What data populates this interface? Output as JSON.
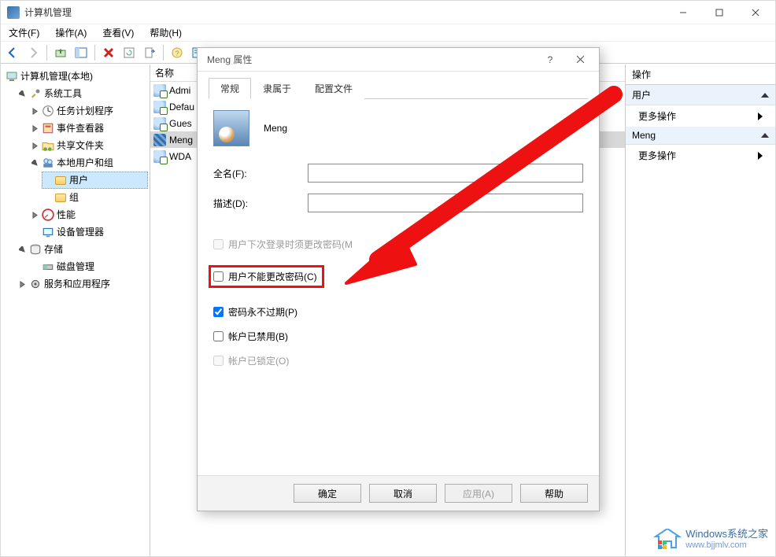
{
  "window": {
    "title": "计算机管理"
  },
  "menu": {
    "file": "文件(F)",
    "action": "操作(A)",
    "view": "查看(V)",
    "help": "帮助(H)"
  },
  "tree": {
    "root": "计算机管理(本地)",
    "system_tools": "系统工具",
    "task_scheduler": "任务计划程序",
    "event_viewer": "事件查看器",
    "shared_folders": "共享文件夹",
    "local_users_groups": "本地用户和组",
    "users": "用户",
    "groups": "组",
    "performance": "性能",
    "device_manager": "设备管理器",
    "storage": "存储",
    "disk_mgmt": "磁盘管理",
    "services_apps": "服务和应用程序"
  },
  "list": {
    "header_name": "名称",
    "items": [
      {
        "label": "Admi"
      },
      {
        "label": "Defau"
      },
      {
        "label": "Gues"
      },
      {
        "label": "Meng"
      },
      {
        "label": "WDA"
      }
    ]
  },
  "actions": {
    "title": "操作",
    "group1": "用户",
    "more1": "更多操作",
    "group2": "Meng",
    "more2": "更多操作"
  },
  "dialog": {
    "title": "Meng 属性",
    "tabs": {
      "general": "常规",
      "member_of": "隶属于",
      "profile": "配置文件"
    },
    "username": "Meng",
    "labels": {
      "fullname": "全名(F):",
      "description": "描述(D):"
    },
    "fields": {
      "fullname": "",
      "description": ""
    },
    "checks": {
      "must_change": "用户下次登录时须更改密码(M",
      "cannot_change": "用户不能更改密码(C)",
      "never_expires": "密码永不过期(P)",
      "disabled": "帐户已禁用(B)",
      "locked": "帐户已锁定(O)"
    },
    "buttons": {
      "ok": "确定",
      "cancel": "取消",
      "apply": "应用(A)",
      "help": "帮助"
    }
  },
  "watermark": {
    "line1": "Windows系统之家",
    "line2": "www.bjjmlv.com"
  }
}
